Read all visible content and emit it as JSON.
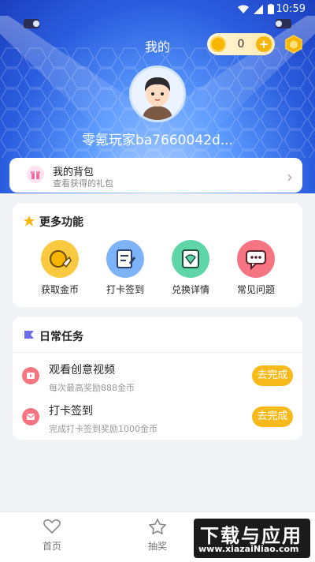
{
  "status_bar": {
    "time": "10:59"
  },
  "header": {
    "title": "我的",
    "coin_count": "0",
    "username": "零氪玩家ba7660042d..."
  },
  "backpack": {
    "title": "我的背包",
    "subtitle": "查看获得的礼包"
  },
  "more_features": {
    "title": "更多功能",
    "items": [
      {
        "label": "获取金币",
        "color": "#f9c940",
        "icon": "coin-hand-icon"
      },
      {
        "label": "打卡签到",
        "color": "#7fb3f8",
        "icon": "checkin-icon"
      },
      {
        "label": "兑换详情",
        "color": "#5fd6a8",
        "icon": "exchange-icon"
      },
      {
        "label": "常见问题",
        "color": "#f57582",
        "icon": "chat-icon"
      }
    ]
  },
  "daily_tasks": {
    "title": "日常任务",
    "items": [
      {
        "name": "观看创意视频",
        "desc": "每次最高奖励888金币",
        "button": "去完成"
      },
      {
        "name": "打卡签到",
        "desc": "完成打卡签到奖励1000金币",
        "button": "去完成"
      }
    ]
  },
  "tabbar": [
    {
      "label": "首页"
    },
    {
      "label": "抽奖"
    }
  ],
  "watermark": {
    "title": "下载与应用",
    "url": "www.xiazaiNiao.com"
  }
}
